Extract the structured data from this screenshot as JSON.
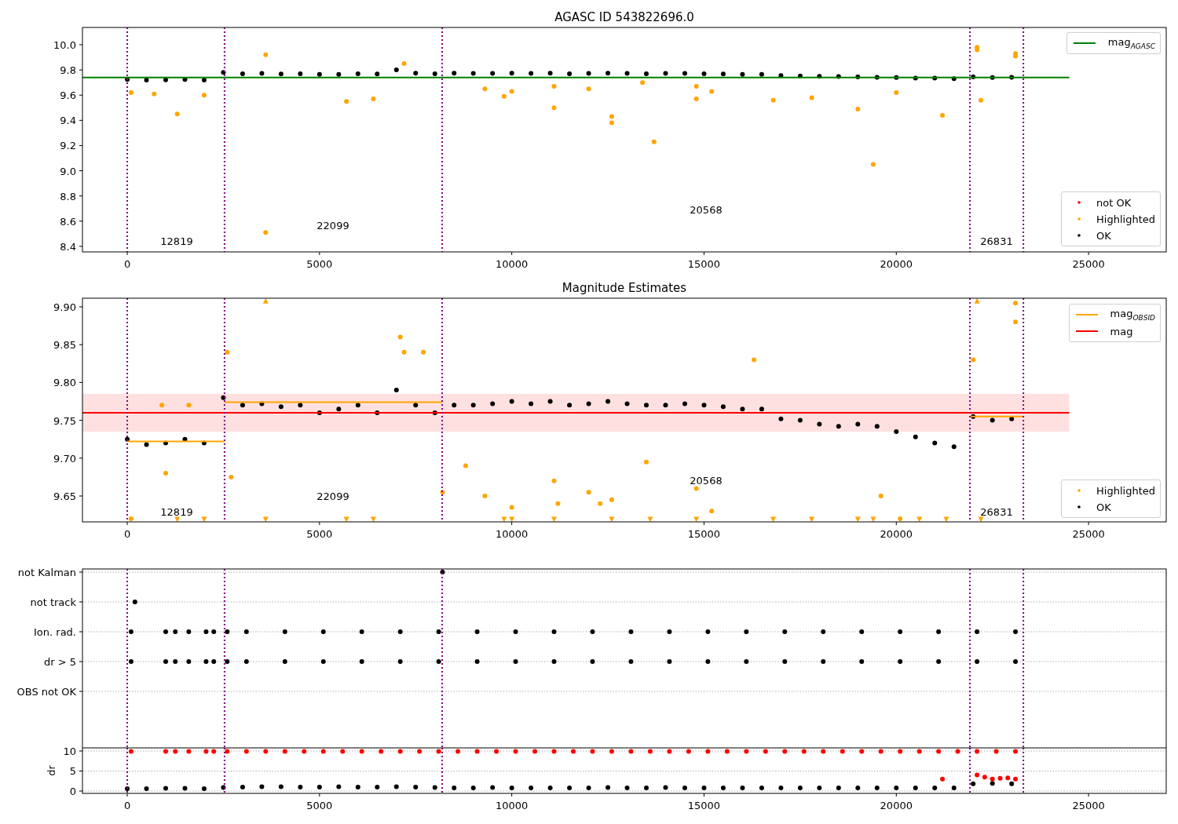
{
  "figure": {
    "panels": [
      {
        "legends": [
          {
            "items": [
              {
                "label": "mag$_{AGASC}$",
                "color": "#008000",
                "kind": "line"
              }
            ]
          },
          {
            "items": [
              {
                "label": "not OK",
                "color": "#ff0000",
                "kind": "dot"
              },
              {
                "label": "Highlighted",
                "color": "#ffa500",
                "kind": "dot"
              },
              {
                "label": "OK",
                "color": "#000000",
                "kind": "dot"
              }
            ]
          }
        ],
        "chart_data": {
          "type": "scatter",
          "title": "AGASC ID 543822696.0",
          "xlim": [
            -1165,
            27020
          ],
          "ylim": [
            8.356,
            10.137
          ],
          "xticks": [
            0,
            5000,
            10000,
            15000,
            20000,
            25000
          ],
          "yticks": [
            {
              "value": 8.4,
              "label": "8.4"
            },
            {
              "value": 8.6,
              "label": "8.6"
            },
            {
              "value": 8.8,
              "label": "8.8"
            },
            {
              "value": 9.0,
              "label": "9.0"
            },
            {
              "value": 9.2,
              "label": "9.2"
            },
            {
              "value": 9.4,
              "label": "9.4"
            },
            {
              "value": 9.6,
              "label": "9.6"
            },
            {
              "value": 9.8,
              "label": "9.8"
            },
            {
              "value": 10.0,
              "label": "10.0"
            }
          ],
          "series": [
            {
              "color": "#000000",
              "type": "scatter",
              "x": [
                0,
                500,
                1000,
                1500,
                2000,
                2500,
                3000,
                3500,
                4000,
                4500,
                5000,
                5500,
                6000,
                6500,
                7000,
                7500,
                8000,
                8500,
                9000,
                9500,
                10000,
                10500,
                11000,
                11500,
                12000,
                12500,
                13000,
                13500,
                14000,
                14500,
                15000,
                15500,
                16000,
                16500,
                17000,
                17500,
                18000,
                18500,
                19000,
                19500,
                20000,
                20500,
                21000,
                21500,
                22000,
                22500,
                23000
              ],
              "values": [
                9.725,
                9.72,
                9.722,
                9.725,
                9.72,
                9.78,
                9.77,
                9.772,
                9.768,
                9.77,
                9.765,
                9.765,
                9.77,
                9.768,
                9.8,
                9.775,
                9.77,
                9.775,
                9.772,
                9.772,
                9.775,
                9.772,
                9.775,
                9.77,
                9.772,
                9.775,
                9.772,
                9.77,
                9.772,
                9.772,
                9.77,
                9.768,
                9.765,
                9.765,
                9.755,
                9.752,
                9.75,
                9.748,
                9.745,
                9.742,
                9.74,
                9.735,
                9.735,
                9.73,
                9.745,
                9.74,
                9.742
              ]
            },
            {
              "color": "#008000",
              "type": "line",
              "x": [
                -1165,
                24500
              ],
              "values": [
                9.74,
                9.74
              ]
            },
            {
              "color": "#ffa500",
              "type": "scatter",
              "x": [
                100,
                700,
                1300,
                2000,
                3600,
                3600,
                5700,
                6400,
                7200,
                9300,
                9800,
                10000,
                11100,
                11100,
                12000,
                12600,
                12600,
                13400,
                13700,
                14800,
                14800,
                15200,
                16800,
                17800,
                19000,
                19400,
                20000,
                21200,
                22100,
                22100,
                22200,
                23100,
                23100
              ],
              "values": [
                9.62,
                9.61,
                9.45,
                9.6,
                9.92,
                8.51,
                9.55,
                9.57,
                9.85,
                9.65,
                9.59,
                9.63,
                9.5,
                9.67,
                9.65,
                9.43,
                9.38,
                9.7,
                9.23,
                9.57,
                9.67,
                9.63,
                9.56,
                9.58,
                9.49,
                9.05,
                9.62,
                9.44,
                9.98,
                9.96,
                9.56,
                9.93,
                9.91
              ]
            }
          ],
          "ref_lines": [
            {
              "axis": "x",
              "value": 0,
              "color": "#800080"
            },
            {
              "axis": "x",
              "value": 2530,
              "color": "#800080"
            },
            {
              "axis": "x",
              "value": 8190,
              "color": "#800080"
            },
            {
              "axis": "x",
              "value": 21916,
              "color": "#800080"
            },
            {
              "axis": "x",
              "value": 23305,
              "color": "#800080"
            }
          ],
          "annotations": [
            "12819",
            "22099",
            "20568",
            "26831"
          ]
        }
      },
      {
        "legends": [
          {
            "items": [
              {
                "label": "mag$_{OBSID}$",
                "color": "#ffa500",
                "kind": "line"
              },
              {
                "label": "mag",
                "color": "#ff0000",
                "kind": "line"
              }
            ]
          },
          {
            "items": [
              {
                "label": "Highlighted",
                "color": "#ffa500",
                "kind": "dot"
              },
              {
                "label": "OK",
                "color": "#000000",
                "kind": "dot"
              }
            ]
          }
        ],
        "chart_data": {
          "type": "scatter",
          "title": "Magnitude Estimates",
          "xlim": [
            -1165,
            27020
          ],
          "ylim": [
            9.6158,
            9.9114
          ],
          "xticks": [
            0,
            5000,
            10000,
            15000,
            20000,
            25000
          ],
          "yticks": [
            {
              "value": 9.65,
              "label": "9.65"
            },
            {
              "value": 9.7,
              "label": "9.70"
            },
            {
              "value": 9.75,
              "label": "9.75"
            },
            {
              "value": 9.8,
              "label": "9.80"
            },
            {
              "value": 9.85,
              "label": "9.85"
            },
            {
              "value": 9.9,
              "label": "9.90"
            }
          ],
          "series": [
            {
              "color": "#000000",
              "type": "scatter",
              "x": [
                0,
                500,
                1000,
                1500,
                2000,
                2500,
                3000,
                3500,
                4000,
                4500,
                5000,
                5500,
                6000,
                6500,
                7000,
                7500,
                8000,
                8500,
                9000,
                9500,
                10000,
                10500,
                11000,
                11500,
                12000,
                12500,
                13000,
                13500,
                14000,
                14500,
                15000,
                15500,
                16000,
                16500,
                17000,
                17500,
                18000,
                18500,
                19000,
                19500,
                20000,
                20500,
                21000,
                21500,
                22000,
                22500,
                23000
              ],
              "values": [
                9.725,
                9.718,
                9.72,
                9.725,
                9.72,
                9.78,
                9.77,
                9.772,
                9.768,
                9.77,
                9.76,
                9.765,
                9.77,
                9.76,
                9.79,
                9.77,
                9.76,
                9.77,
                9.77,
                9.772,
                9.775,
                9.772,
                9.775,
                9.77,
                9.772,
                9.775,
                9.772,
                9.77,
                9.77,
                9.772,
                9.77,
                9.768,
                9.765,
                9.765,
                9.752,
                9.75,
                9.745,
                9.742,
                9.745,
                9.742,
                9.735,
                9.728,
                9.72,
                9.715,
                9.755,
                9.75,
                9.752
              ]
            },
            {
              "color": "#ffa500",
              "type": "line",
              "x": [
                0,
                2530
              ],
              "values": [
                9.722,
                9.722
              ]
            },
            {
              "color": "#ffa500",
              "type": "line",
              "x": [
                2530,
                8190
              ],
              "values": [
                9.774,
                9.774
              ]
            },
            {
              "color": "#ffa500",
              "type": "line",
              "x": [
                21916,
                23305
              ],
              "values": [
                9.755,
                9.755
              ]
            },
            {
              "color": "#ff0000",
              "type": "line",
              "x": [
                -1165,
                24500
              ],
              "values": [
                9.76,
                9.76
              ]
            },
            {
              "color": "#ffa500",
              "type": "scatter",
              "x": [
                100,
                900,
                1000,
                1600,
                2600,
                2700,
                7100,
                7200,
                7700,
                8200,
                8800,
                9300,
                10000,
                11100,
                11200,
                12000,
                12300,
                12600,
                13500,
                14800,
                15200,
                16300,
                19600,
                20100,
                22000,
                23100,
                23100
              ],
              "values": [
                9.62,
                9.77,
                9.68,
                9.77,
                9.84,
                9.675,
                9.86,
                9.84,
                9.84,
                9.655,
                9.69,
                9.65,
                9.635,
                9.67,
                9.64,
                9.655,
                9.64,
                9.645,
                9.695,
                9.66,
                9.63,
                9.83,
                9.65,
                9.62,
                9.83,
                9.88,
                9.905
              ]
            },
            {
              "color": "#ffa500",
              "type": "scatter",
              "marker": "triangle",
              "x": [
                3600,
                22100,
                1300,
                2000,
                3600,
                5700,
                6400,
                9800,
                10000,
                11100,
                12600,
                13600,
                14800,
                16800,
                17800,
                19000,
                19400,
                20600,
                21300,
                22200
              ],
              "values": [
                9.908,
                9.908,
                9.619,
                9.619,
                9.619,
                9.619,
                9.619,
                9.619,
                9.619,
                9.619,
                9.619,
                9.619,
                9.619,
                9.619,
                9.619,
                9.619,
                9.619,
                9.619,
                9.619,
                9.619
              ]
            }
          ],
          "bands": [
            {
              "axis": "y",
              "from": 9.735,
              "to": 9.785,
              "color": "#ff0000"
            }
          ],
          "ref_lines": [
            {
              "axis": "x",
              "value": 0,
              "color": "#800080"
            },
            {
              "axis": "x",
              "value": 2530,
              "color": "#800080"
            },
            {
              "axis": "x",
              "value": 8190,
              "color": "#800080"
            },
            {
              "axis": "x",
              "value": 21916,
              "color": "#800080"
            },
            {
              "axis": "x",
              "value": 23305,
              "color": "#800080"
            }
          ],
          "annotations": [
            "12819",
            "22099",
            "20568",
            "26831"
          ]
        }
      },
      {
        "chart_data": {
          "type": "scatter",
          "grid": true,
          "orientation": "horizontal",
          "xlim": [
            -1165,
            27020
          ],
          "categories": [
            "not Kalman",
            "not track",
            "Ion. rad.",
            "dr > 5",
            "OBS not OK"
          ],
          "series": [
            {
              "color": "#000000",
              "values": [
                8200,
                200,
                100,
                100,
                null
              ]
            },
            {
              "color": "#000000",
              "values": [
                null,
                null,
                1000,
                1000,
                null
              ]
            },
            {
              "color": "#000000",
              "values": [
                null,
                null,
                1250,
                1250,
                null
              ]
            },
            {
              "color": "#000000",
              "values": [
                null,
                null,
                1600,
                1600,
                null
              ]
            },
            {
              "color": "#000000",
              "values": [
                null,
                null,
                2050,
                2050,
                null
              ]
            },
            {
              "color": "#000000",
              "values": [
                null,
                null,
                2250,
                2250,
                null
              ]
            },
            {
              "color": "#000000",
              "values": [
                null,
                null,
                2600,
                2600,
                null
              ]
            },
            {
              "color": "#000000",
              "values": [
                null,
                null,
                3100,
                3100,
                null
              ]
            },
            {
              "color": "#000000",
              "values": [
                null,
                null,
                4100,
                4100,
                null
              ]
            },
            {
              "color": "#000000",
              "values": [
                null,
                null,
                5100,
                5100,
                null
              ]
            },
            {
              "color": "#000000",
              "values": [
                null,
                null,
                6100,
                6100,
                null
              ]
            },
            {
              "color": "#000000",
              "values": [
                null,
                null,
                7100,
                7100,
                null
              ]
            },
            {
              "color": "#000000",
              "values": [
                null,
                null,
                8100,
                8100,
                null
              ]
            },
            {
              "color": "#000000",
              "values": [
                null,
                null,
                9100,
                9100,
                null
              ]
            },
            {
              "color": "#000000",
              "values": [
                null,
                null,
                10100,
                10100,
                null
              ]
            },
            {
              "color": "#000000",
              "values": [
                null,
                null,
                11100,
                11100,
                null
              ]
            },
            {
              "color": "#000000",
              "values": [
                null,
                null,
                12100,
                12100,
                null
              ]
            },
            {
              "color": "#000000",
              "values": [
                null,
                null,
                13100,
                13100,
                null
              ]
            },
            {
              "color": "#000000",
              "values": [
                null,
                null,
                14100,
                14100,
                null
              ]
            },
            {
              "color": "#000000",
              "values": [
                null,
                null,
                15100,
                15100,
                null
              ]
            },
            {
              "color": "#000000",
              "values": [
                null,
                null,
                16100,
                16100,
                null
              ]
            },
            {
              "color": "#000000",
              "values": [
                null,
                null,
                17100,
                17100,
                null
              ]
            },
            {
              "color": "#000000",
              "values": [
                null,
                null,
                18100,
                18100,
                null
              ]
            },
            {
              "color": "#000000",
              "values": [
                null,
                null,
                19100,
                19100,
                null
              ]
            },
            {
              "color": "#000000",
              "values": [
                null,
                null,
                20100,
                20100,
                null
              ]
            },
            {
              "color": "#000000",
              "values": [
                null,
                null,
                21100,
                21100,
                null
              ]
            },
            {
              "color": "#000000",
              "values": [
                null,
                null,
                22100,
                22100,
                null
              ]
            },
            {
              "color": "#000000",
              "values": [
                null,
                null,
                23100,
                23100,
                null
              ]
            }
          ],
          "ref_lines": [
            {
              "axis": "x",
              "value": 0,
              "color": "#800080"
            },
            {
              "axis": "x",
              "value": 2530,
              "color": "#800080"
            },
            {
              "axis": "x",
              "value": 8190,
              "color": "#800080"
            },
            {
              "axis": "x",
              "value": 21916,
              "color": "#800080"
            },
            {
              "axis": "x",
              "value": 23305,
              "color": "#800080"
            }
          ]
        }
      },
      {
        "chart_data": {
          "type": "scatter",
          "grid": true,
          "ylabel": "dr",
          "xlim": [
            -1165,
            27020
          ],
          "ylim": [
            -0.59,
            10.78
          ],
          "xticks": [
            0,
            5000,
            10000,
            15000,
            20000,
            25000
          ],
          "yticks": [
            {
              "value": 0,
              "label": "0"
            },
            {
              "value": 5,
              "label": "5"
            },
            {
              "value": 10,
              "label": "10"
            }
          ],
          "series": [
            {
              "color": "#000000",
              "type": "scatter",
              "x": [
                0,
                500,
                1000,
                1500,
                2000,
                2500,
                3000,
                3500,
                4000,
                4500,
                5000,
                5500,
                6000,
                6500,
                7000,
                7500,
                8000,
                8500,
                9000,
                9500,
                10000,
                10500,
                11000,
                11500,
                12000,
                12500,
                13000,
                13500,
                14000,
                14500,
                15000,
                15500,
                16000,
                16500,
                17000,
                17500,
                18000,
                18500,
                19000,
                19500,
                20000,
                20500,
                21000,
                21500,
                22000,
                22500,
                23000
              ],
              "values": [
                0.6,
                0.6,
                0.7,
                0.7,
                0.6,
                0.9,
                1.0,
                1.1,
                1.1,
                1.0,
                1.0,
                1.1,
                1.0,
                1.0,
                1.1,
                1.0,
                0.9,
                0.8,
                0.8,
                0.9,
                0.8,
                0.8,
                0.8,
                0.8,
                0.8,
                0.9,
                0.8,
                0.8,
                0.9,
                0.8,
                0.8,
                0.8,
                0.8,
                0.8,
                0.8,
                0.8,
                0.8,
                0.8,
                0.8,
                0.8,
                0.8,
                0.8,
                0.8,
                0.8,
                1.8,
                1.9,
                1.8
              ]
            },
            {
              "color": "#ff0000",
              "type": "scatter",
              "x": [
                100,
                1000,
                1250,
                1600,
                2050,
                2250,
                2600,
                3100,
                3600,
                4100,
                4600,
                5100,
                5600,
                6100,
                6600,
                7100,
                7600,
                8100,
                8600,
                9100,
                9600,
                10100,
                10600,
                11100,
                11600,
                12100,
                12600,
                13100,
                13600,
                14100,
                14600,
                15100,
                15600,
                16100,
                16600,
                17100,
                17600,
                18100,
                18600,
                19100,
                19600,
                20100,
                20600,
                21100,
                21600,
                22100,
                22600,
                23100,
                21200,
                22100,
                22300,
                22500,
                22700,
                22900,
                23100
              ],
              "values": [
                9.9,
                9.9,
                9.9,
                9.9,
                9.9,
                9.9,
                9.9,
                9.9,
                9.9,
                9.9,
                9.9,
                9.9,
                9.9,
                9.9,
                9.9,
                9.9,
                9.9,
                9.9,
                9.9,
                9.9,
                9.9,
                9.9,
                9.9,
                9.9,
                9.9,
                9.9,
                9.9,
                9.9,
                9.9,
                9.9,
                9.9,
                9.9,
                9.9,
                9.9,
                9.9,
                9.9,
                9.9,
                9.9,
                9.9,
                9.9,
                9.9,
                9.9,
                9.9,
                9.9,
                9.9,
                9.9,
                9.9,
                9.9,
                3.0,
                4.0,
                3.5,
                3.0,
                3.2,
                3.3,
                3.0
              ]
            }
          ],
          "ref_lines": [
            {
              "axis": "x",
              "value": 0,
              "color": "#800080"
            },
            {
              "axis": "x",
              "value": 2530,
              "color": "#800080"
            },
            {
              "axis": "x",
              "value": 8190,
              "color": "#800080"
            },
            {
              "axis": "x",
              "value": 21916,
              "color": "#800080"
            },
            {
              "axis": "x",
              "value": 23305,
              "color": "#800080"
            }
          ]
        }
      }
    ]
  }
}
